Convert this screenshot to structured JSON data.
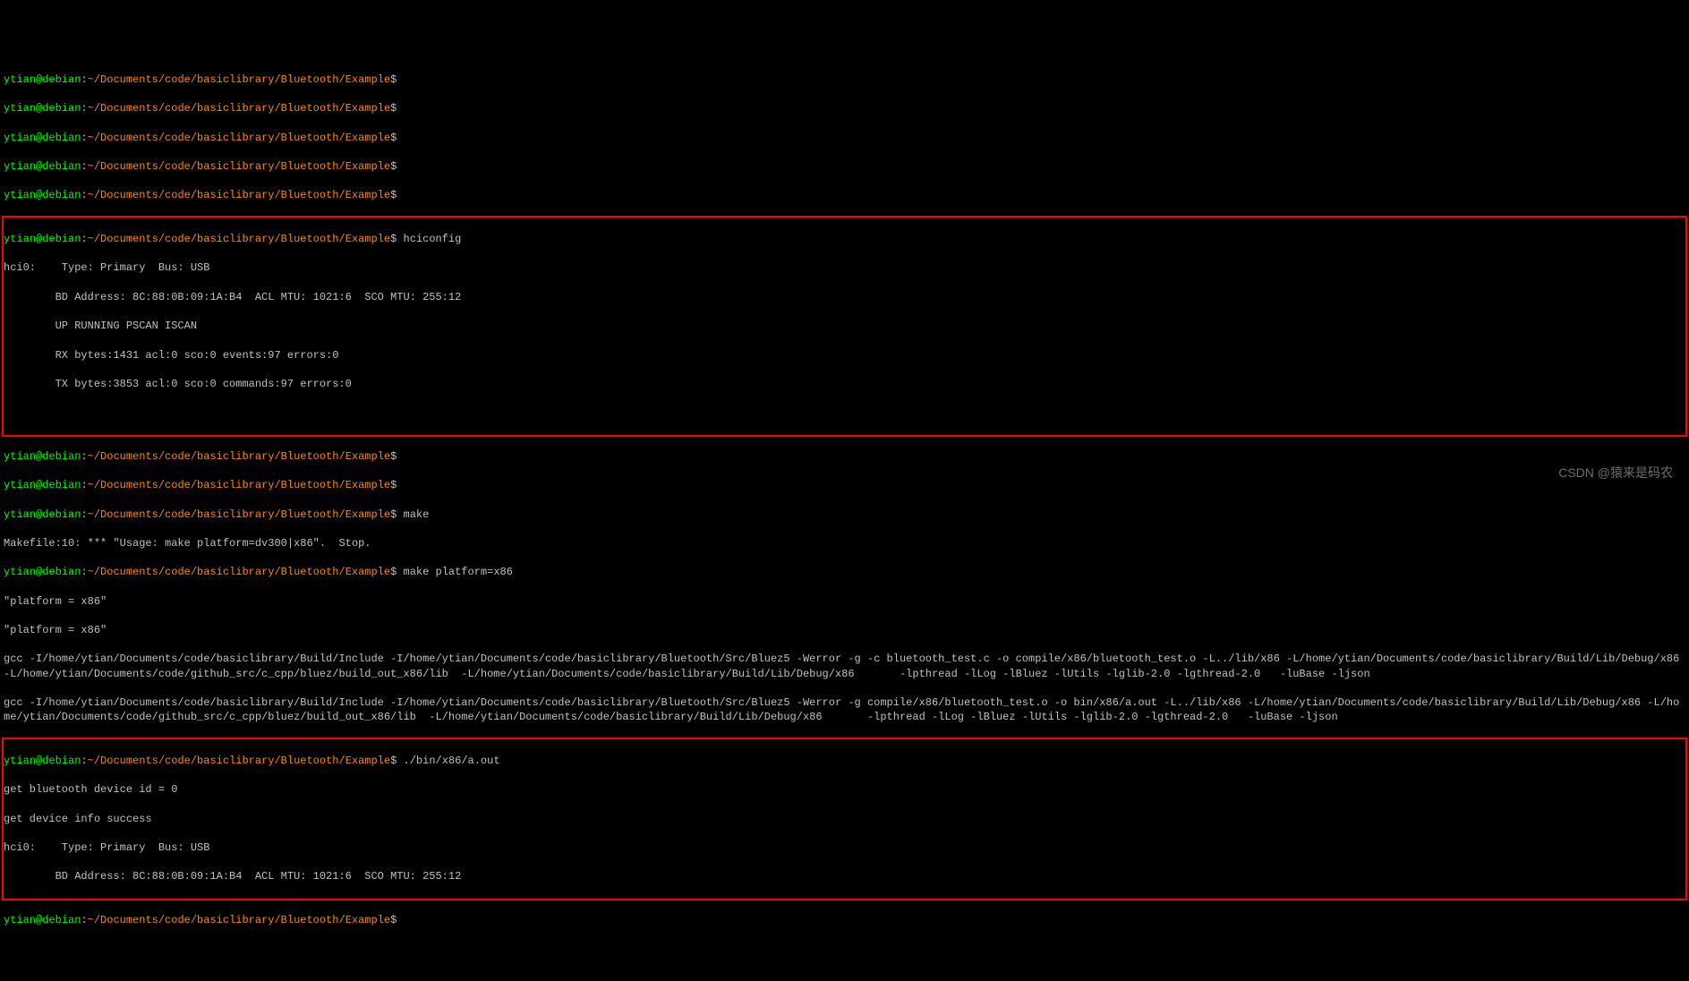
{
  "prompt": {
    "user": "ytian",
    "at": "@",
    "host": "debian",
    "colon": ":",
    "path": "~/Documents/code/basiclibrary/Bluetooth/Example",
    "dollar": "$"
  },
  "cmds": {
    "hciconfig": "hciconfig",
    "make": "make",
    "make_x86": "make platform=x86",
    "run": "./bin/x86/a.out"
  },
  "hci_out": {
    "l1": "hci0:    Type: Primary  Bus: USB",
    "l2": "        BD Address: 8C:88:0B:09:1A:B4  ACL MTU: 1021:6  SCO MTU: 255:12",
    "l3": "        UP RUNNING PSCAN ISCAN ",
    "l4": "        RX bytes:1431 acl:0 sco:0 events:97 errors:0",
    "l5": "        TX bytes:3853 acl:0 sco:0 commands:97 errors:0"
  },
  "make_out": {
    "err": "Makefile:10: *** \"Usage: make platform=dv300|x86\".  Stop.",
    "p1": "\"platform = x86\"",
    "p2": "\"platform = x86\"",
    "gcc1": "gcc -I/home/ytian/Documents/code/basiclibrary/Build/Include -I/home/ytian/Documents/code/basiclibrary/Bluetooth/Src/Bluez5 -Werror -g -c bluetooth_test.c -o compile/x86/bluetooth_test.o -L../lib/x86 -L/home/ytian/Documents/code/basiclibrary/Build/Lib/Debug/x86 -L/home/ytian/Documents/code/github_src/c_cpp/bluez/build_out_x86/lib  -L/home/ytian/Documents/code/basiclibrary/Build/Lib/Debug/x86       -lpthread -lLog -lBluez -lUtils -lglib-2.0 -lgthread-2.0   -luBase -ljson",
    "gcc2": "gcc -I/home/ytian/Documents/code/basiclibrary/Build/Include -I/home/ytian/Documents/code/basiclibrary/Bluetooth/Src/Bluez5 -Werror -g compile/x86/bluetooth_test.o -o bin/x86/a.out -L../lib/x86 -L/home/ytian/Documents/code/basiclibrary/Build/Lib/Debug/x86 -L/home/ytian/Documents/code/github_src/c_cpp/bluez/build_out_x86/lib  -L/home/ytian/Documents/code/basiclibrary/Build/Lib/Debug/x86       -lpthread -lLog -lBluez -lUtils -lglib-2.0 -lgthread-2.0   -luBase -ljson"
  },
  "run_out": {
    "l1": "get bluetooth device id = 0",
    "l2": "get device info success",
    "l3": "hci0:    Type: Primary  Bus: USB",
    "l4": "        BD Address: 8C:88:0B:09:1A:B4  ACL MTU: 1021:6  SCO MTU: 255:12"
  },
  "watermark": "CSDN @猿来是码农"
}
